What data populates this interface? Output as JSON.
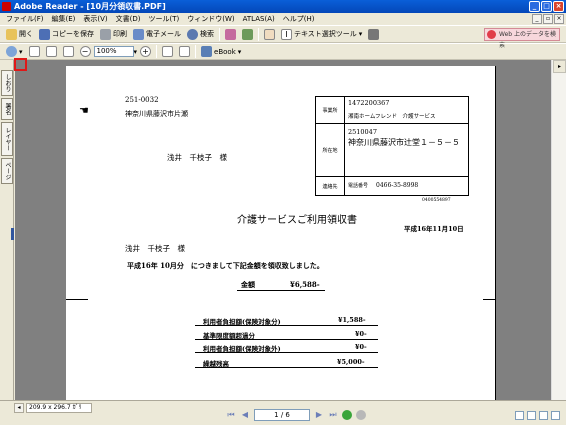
{
  "window": {
    "title": "Adobe Reader - [10月分領収書.PDF]"
  },
  "menu": [
    "ファイル(F)",
    "編集(E)",
    "表示(V)",
    "文書(D)",
    "ツール(T)",
    "ウィンドウ(W)",
    "ATLAS(A)",
    "ヘルプ(H)"
  ],
  "toolbar1": {
    "open": "開く",
    "save_copy": "コピーを保存",
    "print": "印刷",
    "email": "電子メール",
    "search": "検索",
    "text_select": "テキスト選択ツール",
    "web_button": "Web 上のデータを検索"
  },
  "toolbar2": {
    "zoom": "100%",
    "ebook": "eBook"
  },
  "left_tabs": [
    "しおり",
    "署名",
    "レイヤー",
    "ページ"
  ],
  "document": {
    "postal": "251-0032",
    "address": "神奈川県藤沢市片瀬",
    "recipient": "浅井　千枝子　様",
    "provider_table": {
      "office_label": "事業所",
      "office_id": "1472200367",
      "office_name": "湘南ホームフレンド　介護サービス",
      "location_label": "所在地",
      "location_postal": "2510047",
      "location_address": "神奈川県藤沢市辻堂１－５－５",
      "contact_label": "連絡先",
      "phone_label": "電話番号",
      "phone": "0466-35-8998"
    },
    "doc_no": "0400554897",
    "title": "介護サービスご利用領収書",
    "date": "平成16年11月10日",
    "recipient2": "浅井　千枝子　様",
    "statement": "平成16年 10月分　につきまして下記金額を領収致しました。",
    "amount_label": "金額",
    "amount_value": "¥6,588-",
    "breakdown": [
      {
        "label": "利用者負担額(保険対象分)",
        "value": "¥1,588-"
      },
      {
        "label": "基準限度額超過分",
        "value": "¥0-"
      },
      {
        "label": "利用者負担額(保険対象外)",
        "value": "¥0-"
      },
      {
        "label": "繰越残高",
        "value": "¥5,000-"
      }
    ]
  },
  "status": {
    "page_size": "209.9 x 296.7 ｶﾞﾘ",
    "page_indicator": "1 / 6"
  }
}
